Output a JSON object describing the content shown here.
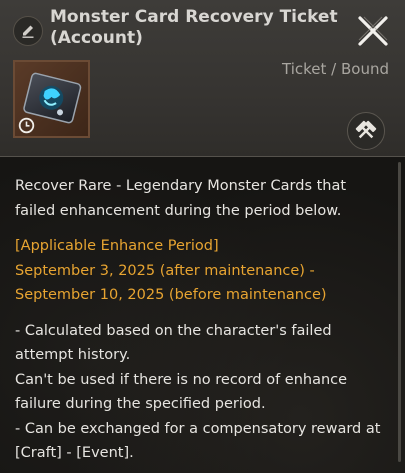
{
  "item": {
    "title": "Monster Card Recovery Ticket (Account)",
    "type": "Ticket / Bound",
    "icons": {
      "edit": "pencil-icon",
      "close": "close-x-icon",
      "timer": "clock-icon",
      "craft": "crossed-hammers-icon"
    }
  },
  "description": {
    "intro": "Recover Rare - Legendary Monster Cards that failed enhancement during the period below.",
    "period_heading": "[Applicable Enhance Period]",
    "period_text": "September 3, 2025 (after maintenance) - September 10, 2025 (before maintenance)",
    "note1": "- Calculated based on the character's failed attempt history.",
    "note2": "Can't be used if there is no record of enhance failure during the specified period.",
    "note3": "- Can be exchanged for a compensatory reward at [Craft] - [Event]."
  },
  "colors": {
    "highlight": "#e7a431",
    "text": "#e6e4e0",
    "title": "#d8d6d2"
  }
}
